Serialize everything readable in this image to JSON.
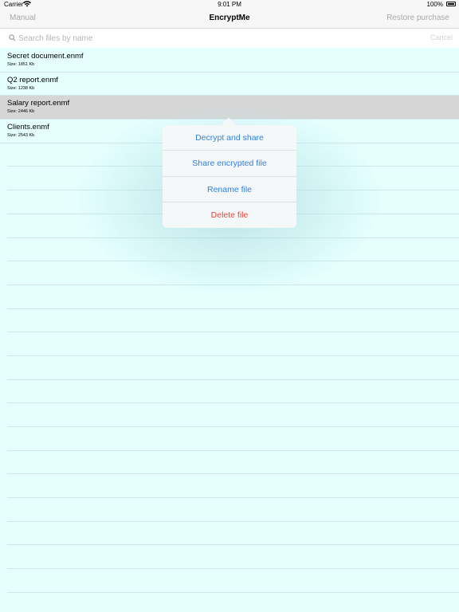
{
  "status_bar": {
    "carrier": "Carrier",
    "time": "9:01 PM",
    "battery": "100%"
  },
  "nav": {
    "left": "Manual",
    "title": "EncryptMe",
    "right": "Restore purchase"
  },
  "search": {
    "placeholder": "Search files by name",
    "value": "",
    "cancel": "Cancel"
  },
  "files": [
    {
      "name": "Secret document.enmf",
      "size": "Size: 1851 Kb"
    },
    {
      "name": "Q2 report.enmf",
      "size": "Size: 1238 Kb"
    },
    {
      "name": "Salary report.enmf",
      "size": "Size: 2446 Kb"
    },
    {
      "name": "Clients.enmf",
      "size": "Size: 2543 Kb"
    }
  ],
  "menu": {
    "decrypt_share": "Decrypt and share",
    "share_encrypted": "Share encrypted file",
    "rename": "Rename file",
    "delete": "Delete file"
  },
  "colors": {
    "list_background": "#e6ffff",
    "accent": "#2f7fe0",
    "destructive": "#e8433a",
    "selected_row": "#d6d6d6"
  }
}
